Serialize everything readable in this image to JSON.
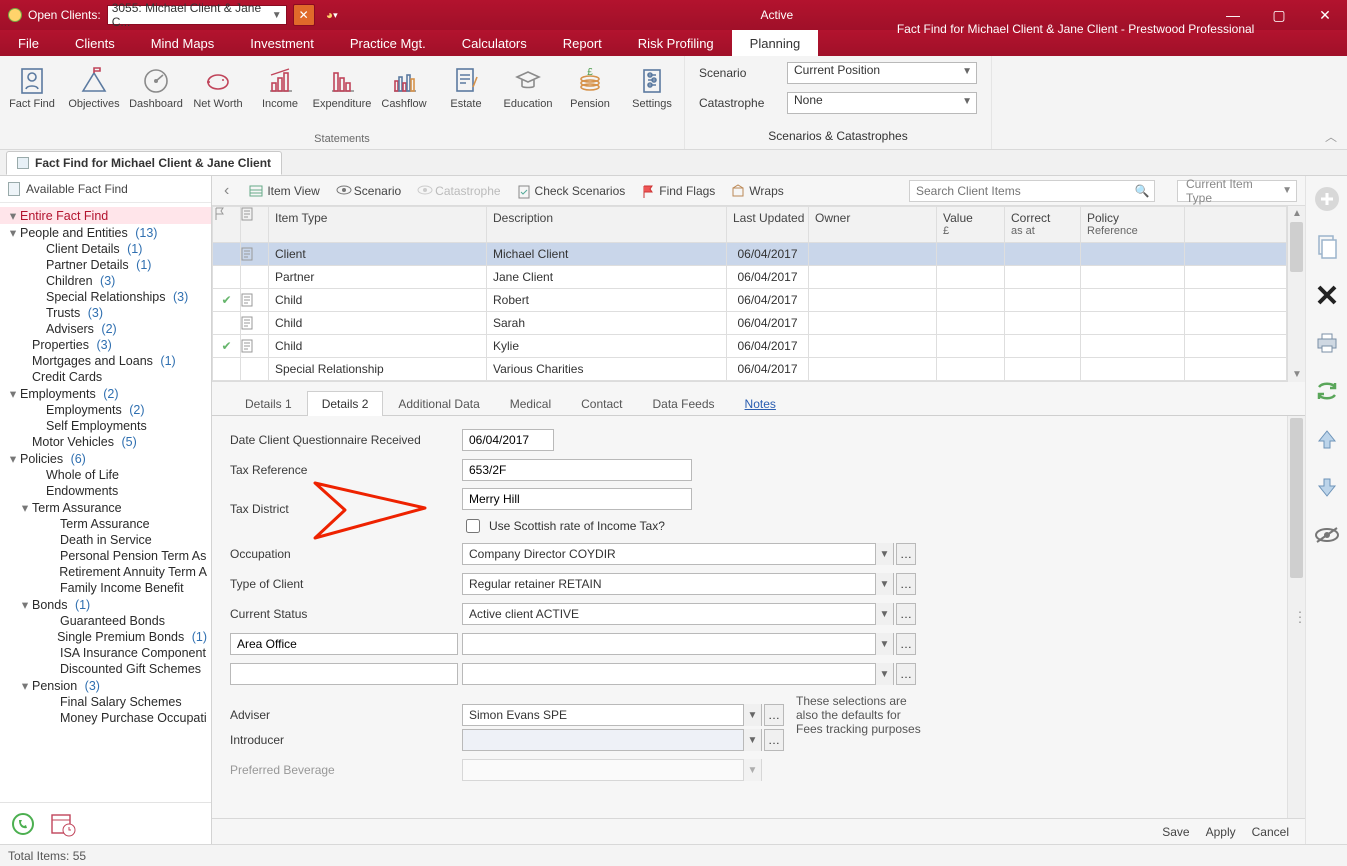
{
  "titlebar": {
    "open_clients_label": "Open Clients:",
    "open_clients_value": "3055: Michael Client & Jane C...",
    "active_label": "Active",
    "doc_title": "Fact Find for Michael Client & Jane Client - Prestwood Professional"
  },
  "menus": [
    "File",
    "Clients",
    "Mind Maps",
    "Investment",
    "Practice Mgt.",
    "Calculators",
    "Report",
    "Risk Profiling",
    "Planning"
  ],
  "menu_active": "Planning",
  "ribbon": {
    "statements": {
      "label": "Statements",
      "buttons": [
        "Fact Find",
        "Objectives",
        "Dashboard",
        "Net Worth",
        "Income",
        "Expenditure",
        "Cashflow",
        "Estate",
        "Education",
        "Pension",
        "Settings"
      ]
    },
    "scenarios": {
      "label": "Scenarios & Catastrophes",
      "scenario_label": "Scenario",
      "scenario_value": "Current Position",
      "catastrophe_label": "Catastrophe",
      "catastrophe_value": "None"
    }
  },
  "doctab": {
    "title": "Fact Find for Michael Client & Jane Client"
  },
  "sidebar": {
    "header": "Available Fact Find",
    "items": [
      {
        "t": "Entire Fact Find",
        "tw": "▾",
        "ind": 0,
        "sel": true
      },
      {
        "t": "People and Entities",
        "cnt": "(13)",
        "tw": "▾",
        "ind": 0
      },
      {
        "t": "Client Details",
        "cnt": "(1)",
        "ind": 2
      },
      {
        "t": "Partner Details",
        "cnt": "(1)",
        "ind": 2
      },
      {
        "t": "Children",
        "cnt": "(3)",
        "ind": 2
      },
      {
        "t": "Special Relationships",
        "cnt": "(3)",
        "ind": 2
      },
      {
        "t": "Trusts",
        "cnt": "(3)",
        "ind": 2
      },
      {
        "t": "Advisers",
        "cnt": "(2)",
        "ind": 2
      },
      {
        "t": "Properties",
        "cnt": "(3)",
        "ind": 1
      },
      {
        "t": "Mortgages and Loans",
        "cnt": "(1)",
        "ind": 1
      },
      {
        "t": "Credit Cards",
        "ind": 1
      },
      {
        "t": "Employments",
        "cnt": "(2)",
        "tw": "▾",
        "ind": 0
      },
      {
        "t": "Employments",
        "cnt": "(2)",
        "ind": 2
      },
      {
        "t": "Self Employments",
        "ind": 2
      },
      {
        "t": "Motor Vehicles",
        "cnt": "(5)",
        "ind": 1
      },
      {
        "t": "Policies",
        "cnt": "(6)",
        "tw": "▾",
        "ind": 0
      },
      {
        "t": "Whole of Life",
        "ind": 2
      },
      {
        "t": "Endowments",
        "ind": 2
      },
      {
        "t": "Term Assurance",
        "tw": "▾",
        "ind": 1
      },
      {
        "t": "Term Assurance",
        "ind": 3
      },
      {
        "t": "Death in Service",
        "ind": 3
      },
      {
        "t": "Personal Pension Term As",
        "ind": 3
      },
      {
        "t": "Retirement Annuity Term A",
        "ind": 3
      },
      {
        "t": "Family Income Benefit",
        "ind": 3
      },
      {
        "t": "Bonds",
        "cnt": "(1)",
        "tw": "▾",
        "ind": 1
      },
      {
        "t": "Guaranteed Bonds",
        "ind": 3
      },
      {
        "t": "Single Premium Bonds",
        "cnt": "(1)",
        "ind": 3
      },
      {
        "t": "ISA Insurance Component",
        "ind": 3
      },
      {
        "t": "Discounted Gift Schemes",
        "ind": 3
      },
      {
        "t": "Pension",
        "cnt": "(3)",
        "tw": "▾",
        "ind": 1
      },
      {
        "t": "Final Salary Schemes",
        "ind": 3
      },
      {
        "t": "Money Purchase Occupati",
        "ind": 3
      }
    ]
  },
  "toolbar": {
    "items": [
      "Item View",
      "Scenario",
      "Catastrophe",
      "Check Scenarios",
      "Find Flags",
      "Wraps"
    ],
    "search_placeholder": "Search Client Items",
    "current_item_type": "Current Item Type"
  },
  "grid": {
    "headers": {
      "item_type": "Item Type",
      "description": "Description",
      "last_updated": "Last Updated",
      "owner": "Owner",
      "value": "Value",
      "value_sub": "£",
      "correct": "Correct",
      "correct_sub": "as at",
      "policy": "Policy",
      "policy_sub": "Reference"
    },
    "rows": [
      {
        "type": "Client",
        "desc": "Michael Client",
        "date": "06/04/2017",
        "sel": true,
        "note": true
      },
      {
        "type": "Partner",
        "desc": "Jane Client",
        "date": "06/04/2017"
      },
      {
        "type": "Child",
        "desc": "Robert",
        "date": "06/04/2017",
        "flag": true,
        "note": true
      },
      {
        "type": "Child",
        "desc": "Sarah",
        "date": "06/04/2017",
        "note": true
      },
      {
        "type": "Child",
        "desc": "Kylie",
        "date": "06/04/2017",
        "flag": true,
        "note": true
      },
      {
        "type": "Special Relationship",
        "desc": "Various Charities",
        "date": "06/04/2017"
      }
    ]
  },
  "detail_tabs": [
    "Details 1",
    "Details 2",
    "Additional Data",
    "Medical",
    "Contact",
    "Data Feeds",
    "Notes"
  ],
  "detail_tab_active": "Details 2",
  "form": {
    "date_q_label": "Date Client Questionnaire Received",
    "date_q_value": "06/04/2017",
    "taxref_label": "Tax Reference",
    "taxref_value": "653/2F",
    "taxdist_label": "Tax District",
    "taxdist_value": "Merry Hill",
    "scottish_label": "Use Scottish rate of Income Tax?",
    "occupation_label": "Occupation",
    "occupation_value": "Company Director   COYDIR",
    "clienttype_label": "Type of Client",
    "clienttype_value": "Regular retainer   RETAIN",
    "status_label": "Current Status",
    "status_value": "Active client   ACTIVE",
    "area_label": "Area Office",
    "area_value": "",
    "blank_left": "",
    "blank_right": "",
    "adviser_label": "Adviser",
    "adviser_value": "Simon Evans  SPE",
    "adviser_note1": "These selections are",
    "adviser_note2": "also the defaults for",
    "adviser_note3": "Fees tracking purposes",
    "introducer_label": "Introducer",
    "introducer_value": "",
    "prefbev_label": "Preferred Beverage"
  },
  "footer": {
    "save": "Save",
    "apply": "Apply",
    "cancel": "Cancel"
  },
  "status": {
    "total": "Total Items: 55"
  }
}
